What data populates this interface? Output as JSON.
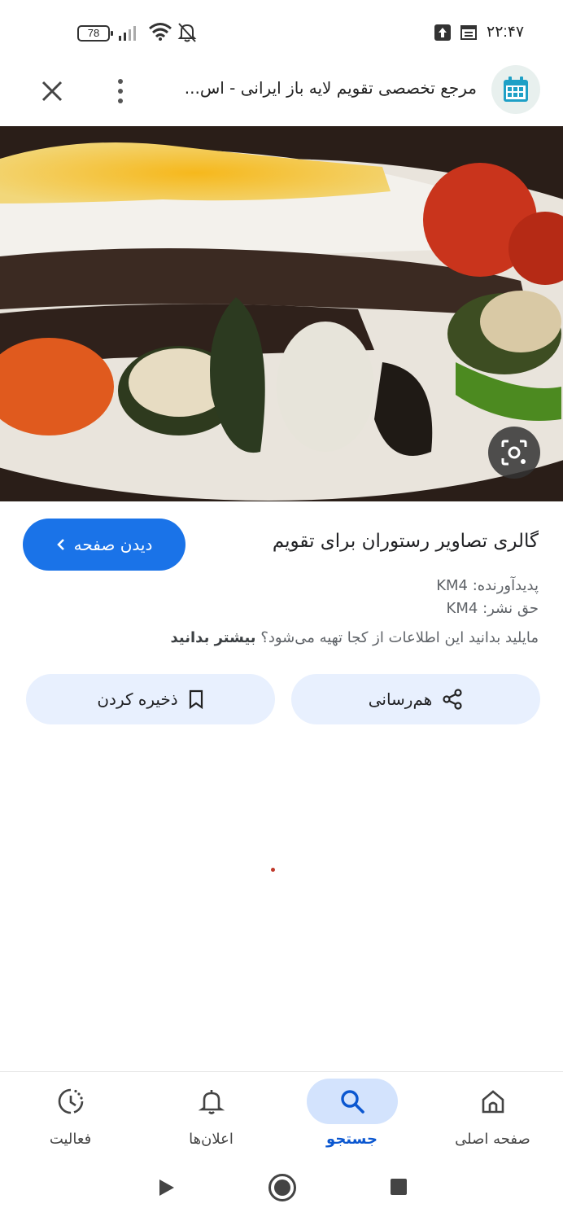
{
  "status_bar": {
    "time": "۲۲:۴۷",
    "battery": "78"
  },
  "header": {
    "title": "مرجع تخصصی تقویم لایه باز ایرانی - اس...",
    "site_icon": "calendar-icon"
  },
  "image": {
    "description_icon": "lens-icon"
  },
  "info": {
    "view_page_label": "دیدن صفحه",
    "title": "گالری تصاویر رستوران برای تقویم",
    "creator": "پدیدآورنده: KM4",
    "copyright": "حق نشر: KM4",
    "more_info_prefix": "مایلید بدانید این اطلاعات از کجا تهیه می‌شود؟",
    "more_info_link": "بیشتر بدانید"
  },
  "actions": {
    "share_label": "هم‌رسانی",
    "save_label": "ذخیره کردن"
  },
  "bottom_nav": {
    "items": [
      {
        "label": "صفحه اصلی",
        "icon": "home-icon",
        "active": false
      },
      {
        "label": "جستجو",
        "icon": "search-icon",
        "active": true
      },
      {
        "label": "اعلان‌ها",
        "icon": "bell-icon",
        "active": false
      },
      {
        "label": "فعالیت",
        "icon": "activity-icon",
        "active": false
      }
    ]
  },
  "colors": {
    "accent": "#1a73e8",
    "pill_bg": "#e8f0fe",
    "active_nav_bg": "#d3e3fd"
  }
}
